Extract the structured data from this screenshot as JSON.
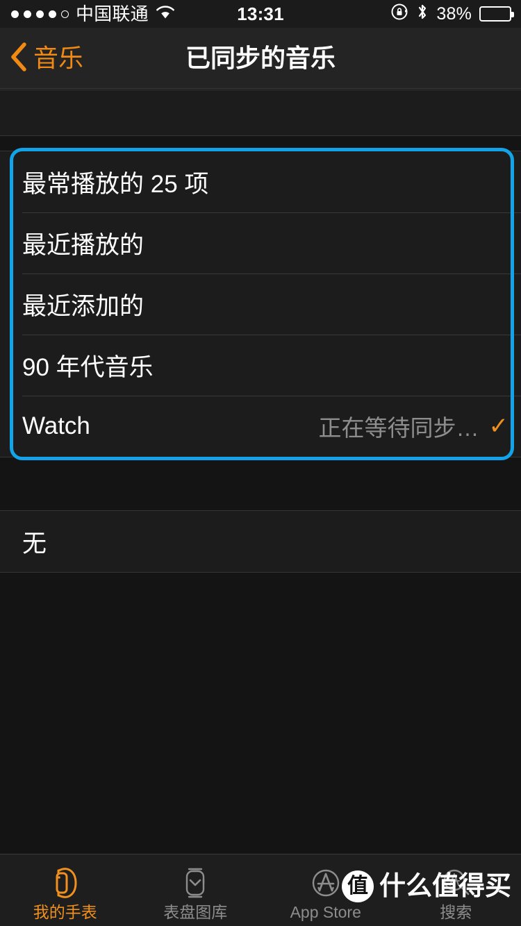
{
  "status_bar": {
    "signal_dots_filled": 4,
    "signal_dots_total": 5,
    "carrier": "中国联通",
    "wifi_icon": "wifi-icon",
    "time": "13:31",
    "rotation_lock_icon": "rotation-lock-icon",
    "bluetooth_icon": "bluetooth-icon",
    "battery_percent": "38%",
    "battery_level": 38
  },
  "nav_bar": {
    "back_icon": "chevron-left-icon",
    "back_label": "音乐",
    "title": "已同步的音乐",
    "accent_color": "#f08a14"
  },
  "highlight": {
    "color": "#13a3e8"
  },
  "sync_list": {
    "rows": [
      {
        "title": "最常播放的 25 项",
        "detail": "",
        "checked": false
      },
      {
        "title": "最近播放的",
        "detail": "",
        "checked": false
      },
      {
        "title": "最近添加的",
        "detail": "",
        "checked": false
      },
      {
        "title": "90 年代音乐",
        "detail": "",
        "checked": false
      },
      {
        "title": "Watch",
        "detail": "正在等待同步…",
        "checked": true,
        "check_glyph": "✓"
      }
    ]
  },
  "none_section": {
    "rows": [
      {
        "title": "无"
      }
    ]
  },
  "tab_bar": {
    "tabs": [
      {
        "label": "我的手表",
        "icon": "watch-side-icon",
        "active": true
      },
      {
        "label": "表盘图库",
        "icon": "watch-face-gallery-icon",
        "active": false
      },
      {
        "label": "App Store",
        "icon": "app-store-icon",
        "active": false
      },
      {
        "label": "搜索",
        "icon": "search-icon",
        "active": false
      }
    ],
    "active_color": "#f0901e",
    "inactive_color": "#8d8d8d"
  },
  "watermark": {
    "badge": "值",
    "text": "什么值得买"
  }
}
